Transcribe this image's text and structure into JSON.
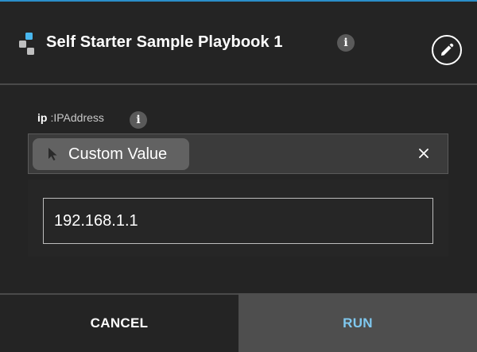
{
  "colors": {
    "accent_top": "#2b8ec9",
    "app_icon_blue": "#49b7ee",
    "app_icon_grey": "#bfbfbf",
    "run_text": "#7fc8ef"
  },
  "header": {
    "title": "Self Starter Sample Playbook 1",
    "info_glyph": "i",
    "app_icon": "playbook-flow-icon",
    "edit_icon": "pencil-icon"
  },
  "parameter": {
    "name": "ip",
    "type": ":IPAddress",
    "info_glyph": "i",
    "selected_option": "Custom Value",
    "option_icon": "cursor-arrow-icon",
    "clear_icon": "close-x-icon",
    "value": "192.168.1.1"
  },
  "footer": {
    "cancel_label": "CANCEL",
    "run_label": "RUN"
  }
}
